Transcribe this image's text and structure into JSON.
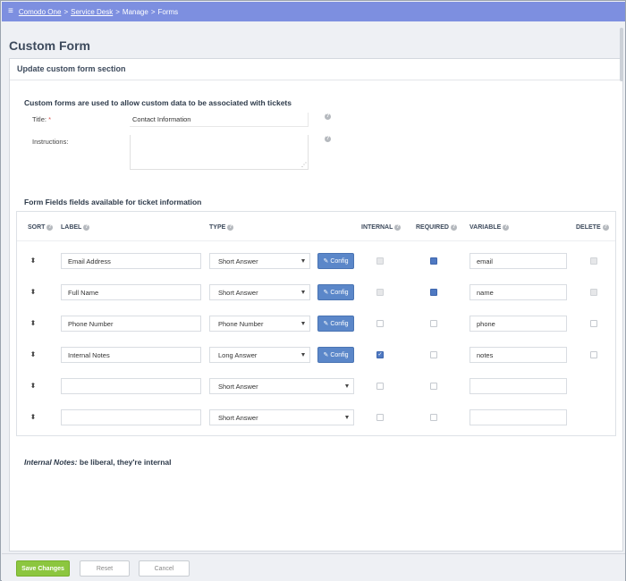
{
  "breadcrumb": {
    "menu_icon": "hamburger-icon",
    "items": [
      "Comodo One",
      "Service Desk",
      "Manage",
      "Forms"
    ],
    "separator": ">"
  },
  "page": {
    "title": "Custom Form",
    "card_header": "Update custom form section",
    "intro": "Custom forms are used to allow custom data to be associated with tickets"
  },
  "form": {
    "title_label": "Title:",
    "required_mark": "*",
    "title_value": "Contact Information",
    "instructions_label": "Instructions:",
    "instructions_value": "",
    "resize_glyph": "⋰"
  },
  "fields_section": {
    "title": "Form Fields fields available for ticket information",
    "columns": {
      "sort": "SORT",
      "label": "LABEL",
      "type": "TYPE",
      "internal": "INTERNAL",
      "required": "REQUIRED",
      "variable": "VARIABLE",
      "delete": "DELETE"
    },
    "sort_glyph": "⬍",
    "config_label": "Config",
    "config_icon": "edit-icon",
    "rows": [
      {
        "label": "Email Address",
        "type": "Short Answer",
        "variable": "email",
        "internal": "disabled",
        "required": "checked",
        "delete": "disabled",
        "has_config": true
      },
      {
        "label": "Full Name",
        "type": "Short Answer",
        "variable": "name",
        "internal": "disabled",
        "required": "checked",
        "delete": "disabled",
        "has_config": true
      },
      {
        "label": "Phone Number",
        "type": "Phone Number",
        "variable": "phone",
        "internal": "unchecked",
        "required": "unchecked",
        "delete": "unchecked",
        "has_config": true
      },
      {
        "label": "Internal Notes",
        "type": "Long Answer",
        "variable": "notes",
        "internal": "checked",
        "required": "unchecked",
        "delete": "unchecked",
        "has_config": true
      },
      {
        "label": "",
        "type": "Short Answer",
        "variable": "",
        "internal": "unchecked",
        "required": "unchecked",
        "delete": "none",
        "has_config": false
      },
      {
        "label": "",
        "type": "Short Answer",
        "variable": "",
        "internal": "unchecked",
        "required": "unchecked",
        "delete": "none",
        "has_config": false
      }
    ]
  },
  "note": {
    "prefix": "Internal Notes:",
    "text": " be liberal, they're internal"
  },
  "footer": {
    "save": "Save Changes",
    "reset": "Reset",
    "cancel": "Cancel"
  },
  "colors": {
    "topbar": "#7d8fe0",
    "primary": "#5b87c9",
    "save": "#8cc63f",
    "required": "#d9534f"
  }
}
